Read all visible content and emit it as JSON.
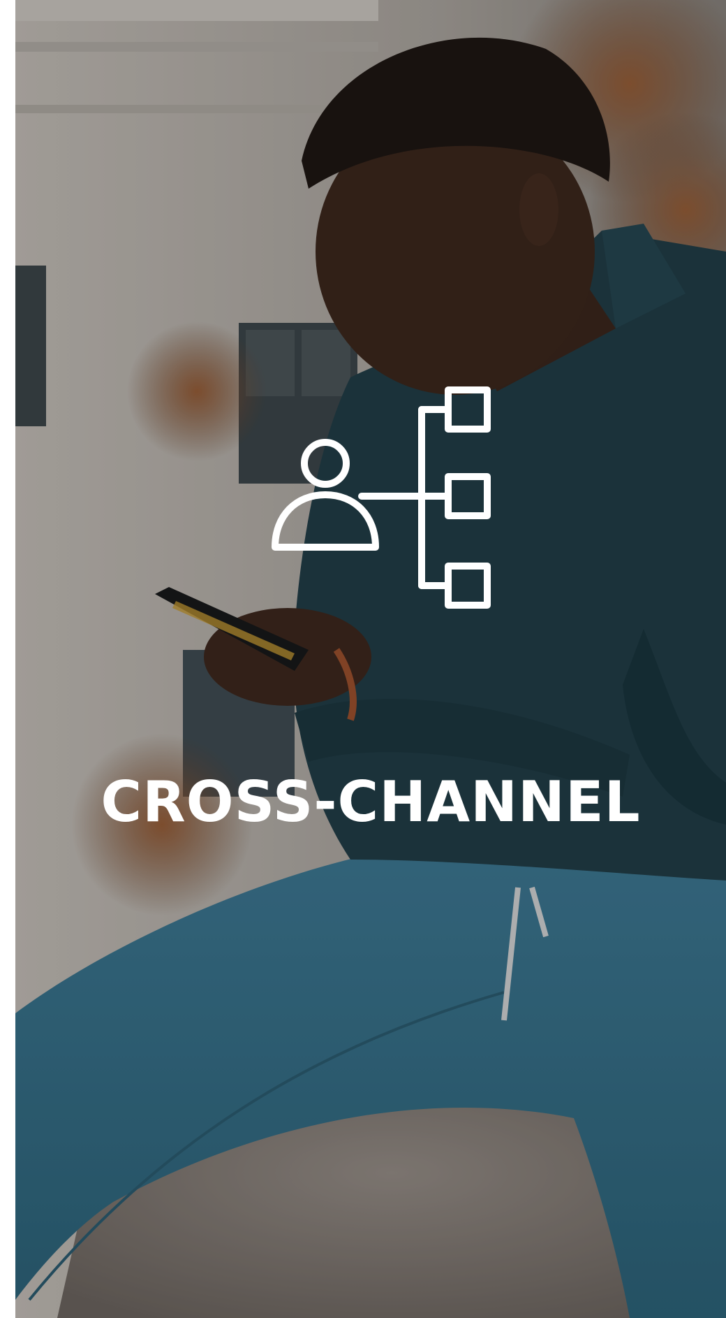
{
  "hero": {
    "headline": "CROSS-CHANNEL",
    "icon": "person-network-icon",
    "text_color": "#ffffff"
  },
  "photo": {
    "icon": "person-with-phone-photo",
    "palette": {
      "building": "#bdb6ae",
      "foliage": "#8a5330",
      "jacket": "#1f3c45",
      "jeans": "#3f7f9a",
      "stone": "#8a8078",
      "skin": "#3b2418"
    }
  }
}
